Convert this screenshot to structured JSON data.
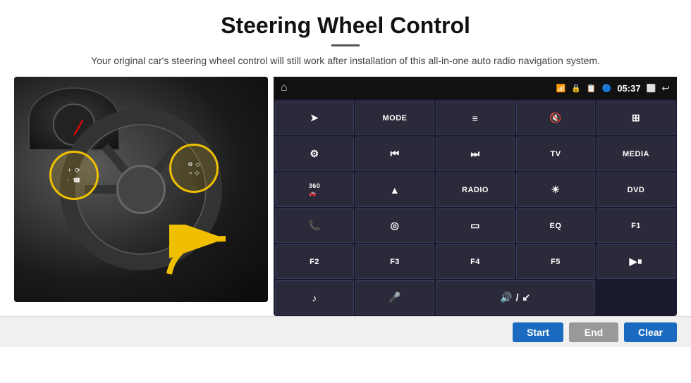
{
  "header": {
    "title": "Steering Wheel Control",
    "subtitle": "Your original car's steering wheel control will still work after installation of this all-in-one auto radio navigation system."
  },
  "statusbar": {
    "home_icon": "⌂",
    "wifi_icon": "📶",
    "bluetooth_icon": "🔒",
    "time": "05:37",
    "back_icon": "↩"
  },
  "panel_buttons": [
    {
      "id": "b1",
      "icon": "➤",
      "label": ""
    },
    {
      "id": "b2",
      "label": "MODE"
    },
    {
      "id": "b3",
      "icon": "≡",
      "label": ""
    },
    {
      "id": "b4",
      "icon": "🔇",
      "label": ""
    },
    {
      "id": "b5",
      "icon": "⊞",
      "label": ""
    },
    {
      "id": "b6",
      "icon": "⚙",
      "label": ""
    },
    {
      "id": "b7",
      "icon": "⏮",
      "label": ""
    },
    {
      "id": "b8",
      "icon": "⏭",
      "label": ""
    },
    {
      "id": "b9",
      "label": "TV"
    },
    {
      "id": "b10",
      "label": "MEDIA"
    },
    {
      "id": "b11",
      "icon": "360",
      "label": ""
    },
    {
      "id": "b12",
      "icon": "▲",
      "label": ""
    },
    {
      "id": "b13",
      "label": "RADIO"
    },
    {
      "id": "b14",
      "icon": "☀",
      "label": ""
    },
    {
      "id": "b15",
      "label": "DVD"
    },
    {
      "id": "b16",
      "icon": "📞",
      "label": ""
    },
    {
      "id": "b17",
      "icon": "◎",
      "label": ""
    },
    {
      "id": "b18",
      "icon": "▭",
      "label": ""
    },
    {
      "id": "b19",
      "label": "EQ"
    },
    {
      "id": "b20",
      "label": "F1"
    },
    {
      "id": "b21",
      "label": "F2"
    },
    {
      "id": "b22",
      "label": "F3"
    },
    {
      "id": "b23",
      "label": "F4"
    },
    {
      "id": "b24",
      "label": "F5"
    },
    {
      "id": "b25",
      "icon": "▶⏸",
      "label": ""
    },
    {
      "id": "b26",
      "icon": "♪",
      "label": ""
    },
    {
      "id": "b27",
      "icon": "🎤",
      "label": ""
    },
    {
      "id": "b28",
      "icon": "🔊↙",
      "label": ""
    },
    {
      "id": "b29",
      "label": ""
    },
    {
      "id": "b30",
      "label": ""
    }
  ],
  "bottom_buttons": {
    "start_label": "Start",
    "end_label": "End",
    "clear_label": "Clear"
  }
}
